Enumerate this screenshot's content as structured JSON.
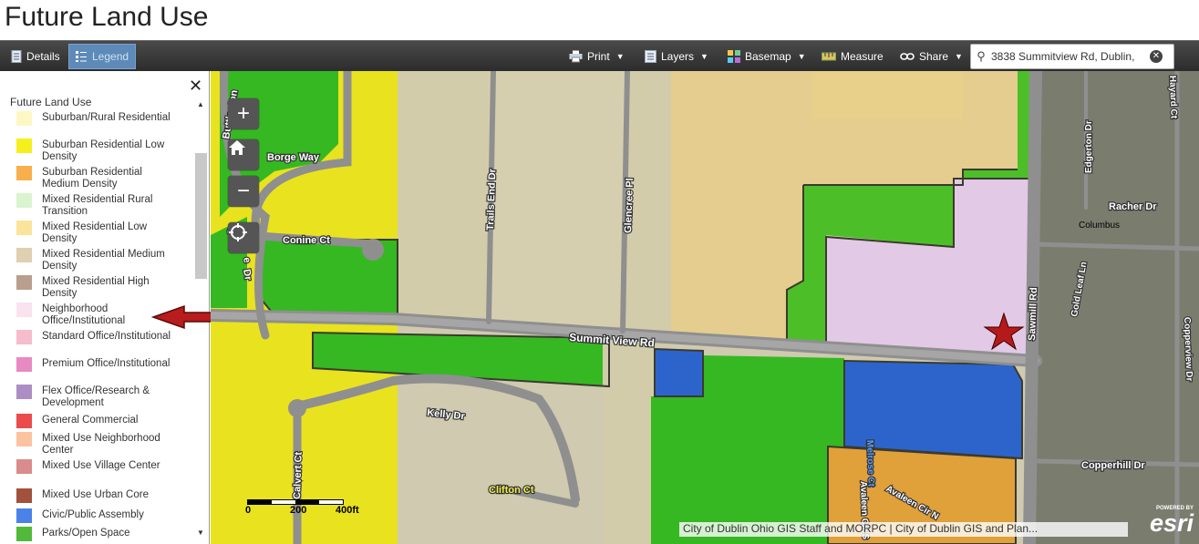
{
  "page_title": "Future Land Use",
  "toolbar": {
    "details_label": "Details",
    "legend_label": "Legend",
    "print_label": "Print",
    "layers_label": "Layers",
    "basemap_label": "Basemap",
    "measure_label": "Measure",
    "share_label": "Share",
    "search_value": "3838 Summitview Rd, Dublin,"
  },
  "legend": {
    "title": "Future Land Use",
    "items": [
      {
        "label": "Suburban/Rural Residential",
        "color": "#fdf7c4"
      },
      {
        "label": "Suburban Residential Low Density",
        "color": "#f6ef1e"
      },
      {
        "label": "Suburban Residential Medium Density",
        "color": "#f7b04b"
      },
      {
        "label": "Mixed Residential Rural Transition",
        "color": "#d9f4cf"
      },
      {
        "label": "Mixed Residential Low Density",
        "color": "#fbe49a"
      },
      {
        "label": "Mixed Residential Medium Density",
        "color": "#e0cfb1"
      },
      {
        "label": "Mixed Residential High Density",
        "color": "#b89f8e"
      },
      {
        "label": "Neighborhood Office/Institutional",
        "color": "#f8e3ef"
      },
      {
        "label": "Standard Office/Institutional",
        "color": "#f7bccc"
      },
      {
        "label": "Premium Office/Institutional",
        "color": "#e889c2"
      },
      {
        "label": "Flex Office/Research & Development",
        "color": "#ac8ec4"
      },
      {
        "label": "General Commercial",
        "color": "#ec4b4b"
      },
      {
        "label": "Mixed Use Neighborhood Center",
        "color": "#fbc3a0"
      },
      {
        "label": "Mixed Use Village Center",
        "color": "#d98c8c"
      },
      {
        "label": "Mixed Use Urban Core",
        "color": "#a1523d"
      },
      {
        "label": "Civic/Public Assembly",
        "color": "#4a82e8"
      },
      {
        "label": "Parks/Open Space",
        "color": "#52ba3a"
      }
    ]
  },
  "map": {
    "streets": {
      "buttleston": "Buttleston",
      "borge_way": "Borge Way",
      "conine_ct": "Conine Ct",
      "dr_fragment": "Dr",
      "c_fragment": "C",
      "e_fragment": "e",
      "trails_end_dr": "Trails End Dr",
      "glencree_pl": "Glencree Pl",
      "summit_view_rd": "Summit View Rd",
      "kelly_dr": "Kelly Dr",
      "calvert_ct": "Calvert Ct",
      "clifton_ct": "Clifton Ct",
      "melrose_ct": "Melrose Ct",
      "avaleen_cir_n": "Avaleen Cir N",
      "avaleen_cir_s": "Avaleen Cir S",
      "sawmill_rd": "Sawmill Rd",
      "edgerton_dr": "Edgerton Dr",
      "hayard_ct": "Hayard Ct",
      "racher_dr": "Racher Dr",
      "columbus": "Columbus",
      "gold_leaf_ln": "Gold Leaf Ln",
      "copperview_dr": "Copperview Dr",
      "copperhill_dr": "Copperhill Dr"
    },
    "scale_labels": [
      "0",
      "200",
      "400ft"
    ],
    "attribution": "City of Dublin Ohio GIS Staff and MORPC | City of Dublin GIS and Plan...",
    "powered_by": "POWERED BY",
    "esri_logo": "esri",
    "colors": {
      "park": "#4cbf28",
      "yellow": "#e9e21e",
      "tan": "#d3ccaa",
      "beige": "#e4cd8e",
      "lavender": "#e2c9e5",
      "blue": "#2d64cc",
      "orange": "#e0a03a",
      "road": "#8f8f8f",
      "star": "#b51a1a"
    }
  }
}
